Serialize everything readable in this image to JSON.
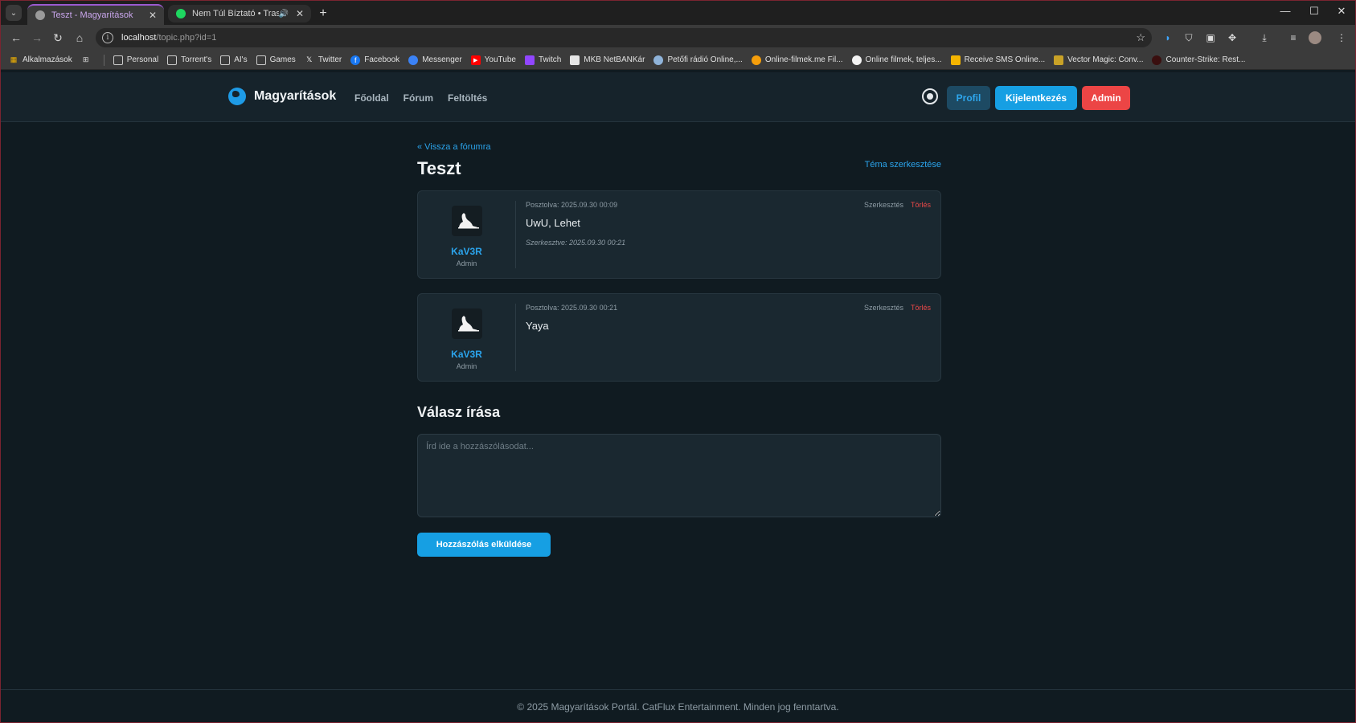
{
  "browser": {
    "tabs": [
      {
        "title": "Teszt - Magyarítások",
        "active": true
      },
      {
        "title": "Nem Túl Bíztató • Trashkat…",
        "active": false
      }
    ],
    "url_host": "localhost",
    "url_path": "/topic.php?id=1",
    "bookmarks": [
      {
        "label": "Alkalmazások",
        "icon": "apps-grid-icon"
      },
      {
        "label": "Personal",
        "icon": "folder-icon"
      },
      {
        "label": "Torrent's",
        "icon": "folder-icon"
      },
      {
        "label": "AI's",
        "icon": "folder-icon"
      },
      {
        "label": "Games",
        "icon": "folder-icon"
      },
      {
        "label": "Twitter",
        "icon": "x-logo-icon"
      },
      {
        "label": "Facebook",
        "icon": "facebook-icon"
      },
      {
        "label": "Messenger",
        "icon": "messenger-icon"
      },
      {
        "label": "YouTube",
        "icon": "youtube-icon"
      },
      {
        "label": "Twitch",
        "icon": "twitch-icon"
      },
      {
        "label": "MKB NetBANKár",
        "icon": "bank-icon"
      },
      {
        "label": "Petőfi rádió Online,...",
        "icon": "radio-icon"
      },
      {
        "label": "Online-filmek.me Fil...",
        "icon": "play-icon"
      },
      {
        "label": "Online filmek, teljes...",
        "icon": "film-icon"
      },
      {
        "label": "Receive SMS Online...",
        "icon": "sms-icon"
      },
      {
        "label": "Vector Magic: Conv...",
        "icon": "vector-magic-icon"
      },
      {
        "label": "Counter-Strike: Rest...",
        "icon": "cs-icon"
      }
    ]
  },
  "site": {
    "brand": "Magyarítások",
    "nav": [
      "Főoldal",
      "Fórum",
      "Feltöltés"
    ],
    "buttons": {
      "profil": "Profil",
      "logout": "Kijelentkezés",
      "admin": "Admin"
    }
  },
  "topic": {
    "back_link": "« Vissza a fórumra",
    "title": "Teszt",
    "edit_topic": "Téma szerkesztése",
    "posts": [
      {
        "author": "KaV3R",
        "role": "Admin",
        "meta": "Posztolva: 2025.09.30 00:09",
        "text": "UwU, Lehet",
        "edited": "Szerkesztve: 2025.09.30 00:21",
        "edit_label": "Szerkesztés",
        "delete_label": "Törlés"
      },
      {
        "author": "KaV3R",
        "role": "Admin",
        "meta": "Posztolva: 2025.09.30 00:21",
        "text": "Yaya",
        "edit_label": "Szerkesztés",
        "delete_label": "Törlés"
      }
    ]
  },
  "reply": {
    "title": "Válasz írása",
    "placeholder": "Írd ide a hozzászólásodat...",
    "submit": "Hozzászólás elküldése"
  },
  "footer": {
    "text": "© 2025 Magyarítások Portál. CatFlux Entertainment. Minden jog fenntartva."
  },
  "colors": {
    "accent": "#169fe3",
    "danger": "#ec4545",
    "background": "#101b21",
    "card": "#1a2830"
  }
}
